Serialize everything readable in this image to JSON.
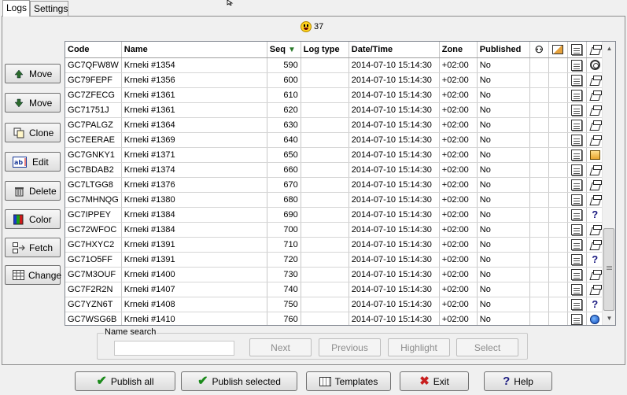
{
  "tabs": [
    {
      "label": "Logs"
    },
    {
      "label": "Settings"
    }
  ],
  "counter": {
    "value": "37"
  },
  "side_buttons": {
    "move_up": "Move",
    "move_down": "Move",
    "clone": "Clone",
    "edit": "Edit",
    "delete": "Delete",
    "color": "Color",
    "fetch": "Fetch",
    "change": "Change"
  },
  "table": {
    "columns": [
      "Code",
      "Name",
      "Seq",
      "Log type",
      "Date/Time",
      "Zone",
      "Published",
      "",
      "",
      "",
      ""
    ],
    "rows": [
      {
        "code": "GC7QFW8W",
        "name": "Krneki #1354",
        "seq": "590",
        "logtype": "",
        "datetime": "2014-07-10 15:14:30",
        "zone": "+02:00",
        "published": "No",
        "type_icon": "webcam-icon"
      },
      {
        "code": "GC79FEPF",
        "name": "Krneki #1356",
        "seq": "600",
        "logtype": "",
        "datetime": "2014-07-10 15:14:30",
        "zone": "+02:00",
        "published": "No",
        "type_icon": "traditional-cache-icon"
      },
      {
        "code": "GC7ZFECG",
        "name": "Krneki #1361",
        "seq": "610",
        "logtype": "",
        "datetime": "2014-07-10 15:14:30",
        "zone": "+02:00",
        "published": "No",
        "type_icon": "traditional-cache-icon"
      },
      {
        "code": "GC71751J",
        "name": "Krneki #1361",
        "seq": "620",
        "logtype": "",
        "datetime": "2014-07-10 15:14:30",
        "zone": "+02:00",
        "published": "No",
        "type_icon": "traditional-cache-icon"
      },
      {
        "code": "GC7PALGZ",
        "name": "Krneki #1364",
        "seq": "630",
        "logtype": "",
        "datetime": "2014-07-10 15:14:30",
        "zone": "+02:00",
        "published": "No",
        "type_icon": "traditional-cache-icon"
      },
      {
        "code": "GC7EERAE",
        "name": "Krneki #1369",
        "seq": "640",
        "logtype": "",
        "datetime": "2014-07-10 15:14:30",
        "zone": "+02:00",
        "published": "No",
        "type_icon": "traditional-cache-icon"
      },
      {
        "code": "GC7GNKY1",
        "name": "Krneki #1371",
        "seq": "650",
        "logtype": "",
        "datetime": "2014-07-10 15:14:30",
        "zone": "+02:00",
        "published": "No",
        "type_icon": "multi-cache-icon"
      },
      {
        "code": "GC7BDAB2",
        "name": "Krneki #1374",
        "seq": "660",
        "logtype": "",
        "datetime": "2014-07-10 15:14:30",
        "zone": "+02:00",
        "published": "No",
        "type_icon": "traditional-cache-icon"
      },
      {
        "code": "GC7LTGG8",
        "name": "Krneki #1376",
        "seq": "670",
        "logtype": "",
        "datetime": "2014-07-10 15:14:30",
        "zone": "+02:00",
        "published": "No",
        "type_icon": "traditional-cache-icon"
      },
      {
        "code": "GC7MHNQG",
        "name": "Krneki #1380",
        "seq": "680",
        "logtype": "",
        "datetime": "2014-07-10 15:14:30",
        "zone": "+02:00",
        "published": "No",
        "type_icon": "traditional-cache-icon"
      },
      {
        "code": "GC7IPPEY",
        "name": "Krneki #1384",
        "seq": "690",
        "logtype": "",
        "datetime": "2014-07-10 15:14:30",
        "zone": "+02:00",
        "published": "No",
        "type_icon": "mystery-cache-icon"
      },
      {
        "code": "GC72WFOC",
        "name": "Krneki #1384",
        "seq": "700",
        "logtype": "",
        "datetime": "2014-07-10 15:14:30",
        "zone": "+02:00",
        "published": "No",
        "type_icon": "traditional-cache-icon"
      },
      {
        "code": "GC7HXYC2",
        "name": "Krneki #1391",
        "seq": "710",
        "logtype": "",
        "datetime": "2014-07-10 15:14:30",
        "zone": "+02:00",
        "published": "No",
        "type_icon": "traditional-cache-icon"
      },
      {
        "code": "GC71O5FF",
        "name": "Krneki #1391",
        "seq": "720",
        "logtype": "",
        "datetime": "2014-07-10 15:14:30",
        "zone": "+02:00",
        "published": "No",
        "type_icon": "mystery-cache-icon"
      },
      {
        "code": "GC7M3OUF",
        "name": "Krneki #1400",
        "seq": "730",
        "logtype": "",
        "datetime": "2014-07-10 15:14:30",
        "zone": "+02:00",
        "published": "No",
        "type_icon": "traditional-cache-icon"
      },
      {
        "code": "GC7F2R2N",
        "name": "Krneki #1407",
        "seq": "740",
        "logtype": "",
        "datetime": "2014-07-10 15:14:30",
        "zone": "+02:00",
        "published": "No",
        "type_icon": "traditional-cache-icon"
      },
      {
        "code": "GC7YZN6T",
        "name": "Krneki #1408",
        "seq": "750",
        "logtype": "",
        "datetime": "2014-07-10 15:14:30",
        "zone": "+02:00",
        "published": "No",
        "type_icon": "mystery-cache-icon"
      },
      {
        "code": "GC7WSG6B",
        "name": "Krneki #1410",
        "seq": "760",
        "logtype": "",
        "datetime": "2014-07-10 15:14:30",
        "zone": "+02:00",
        "published": "No",
        "type_icon": "earthcache-icon"
      }
    ]
  },
  "search": {
    "legend": "Name search",
    "value": "",
    "next": "Next",
    "previous": "Previous",
    "highlight": "Highlight",
    "select": "Select"
  },
  "bottom": {
    "publish_all": "Publish all",
    "publish_selected": "Publish selected",
    "templates": "Templates",
    "exit": "Exit",
    "help": "Help"
  }
}
